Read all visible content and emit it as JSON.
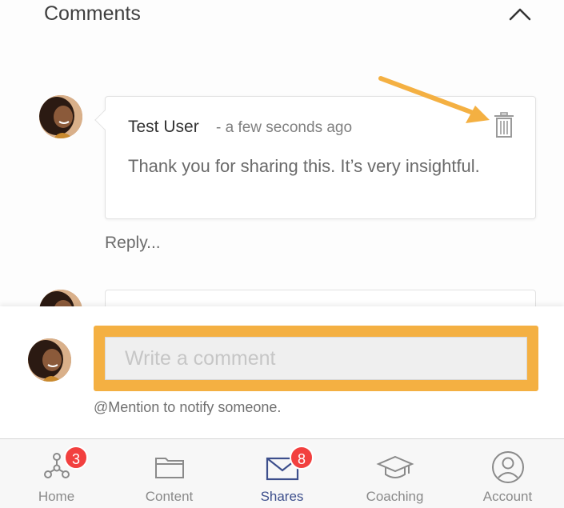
{
  "section": {
    "title": "Comments"
  },
  "comment": {
    "author": "Test User",
    "time": "- a few seconds ago",
    "text": "Thank you for sharing this. It’s very insightful."
  },
  "reply": {
    "label": "Reply..."
  },
  "composer": {
    "placeholder": "Write a comment",
    "hint": "@Mention to notify someone."
  },
  "tabs": [
    {
      "label": "Home",
      "icon": "network-icon",
      "badge": "3"
    },
    {
      "label": "Content",
      "icon": "folder-icon",
      "badge": ""
    },
    {
      "label": "Shares",
      "icon": "envelope-icon",
      "badge": "8",
      "active": true
    },
    {
      "label": "Coaching",
      "icon": "graduation-cap-icon",
      "badge": ""
    },
    {
      "label": "Account",
      "icon": "user-circle-icon",
      "badge": ""
    }
  ],
  "colors": {
    "highlight": "#f4b042",
    "badge": "#f2403f",
    "active_tab": "#3d4f8c",
    "avatar_skin": "#8b5a3a"
  }
}
